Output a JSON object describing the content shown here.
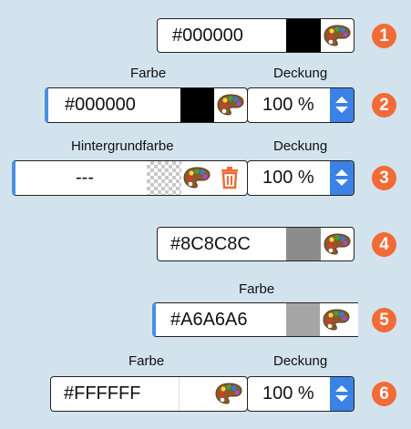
{
  "rows": [
    {
      "hex": "#000000",
      "swatch": "#000000",
      "badge": "1"
    },
    {
      "label_color": "Farbe",
      "label_opacity": "Deckung",
      "hex": "#000000",
      "swatch": "#000000",
      "opacity": "100 %",
      "badge": "2"
    },
    {
      "label_color": "Hintergrundfarbe",
      "label_opacity": "Deckung",
      "hex": "---",
      "swatch": "transparent-checker",
      "opacity": "100 %",
      "badge": "3"
    },
    {
      "hex": "#8C8C8C",
      "swatch": "#8C8C8C",
      "badge": "4"
    },
    {
      "label_color": "Farbe",
      "hex": "#A6A6A6",
      "swatch": "#A6A6A6",
      "badge": "5"
    },
    {
      "label_color": "Farbe",
      "label_opacity": "Deckung",
      "hex": "#FFFFFF",
      "swatch": "#FFFFFF",
      "opacity": "100 %",
      "badge": "6"
    }
  ],
  "colors": {
    "accent": "#4a90e2",
    "stepper": "#3b82e6",
    "badge": "#f26a35",
    "trash": "#f26a35",
    "background": "#d3e3ee"
  },
  "icons": {
    "palette": "palette-icon",
    "trash": "trash-icon",
    "stepper": "up-down-stepper-icon"
  }
}
